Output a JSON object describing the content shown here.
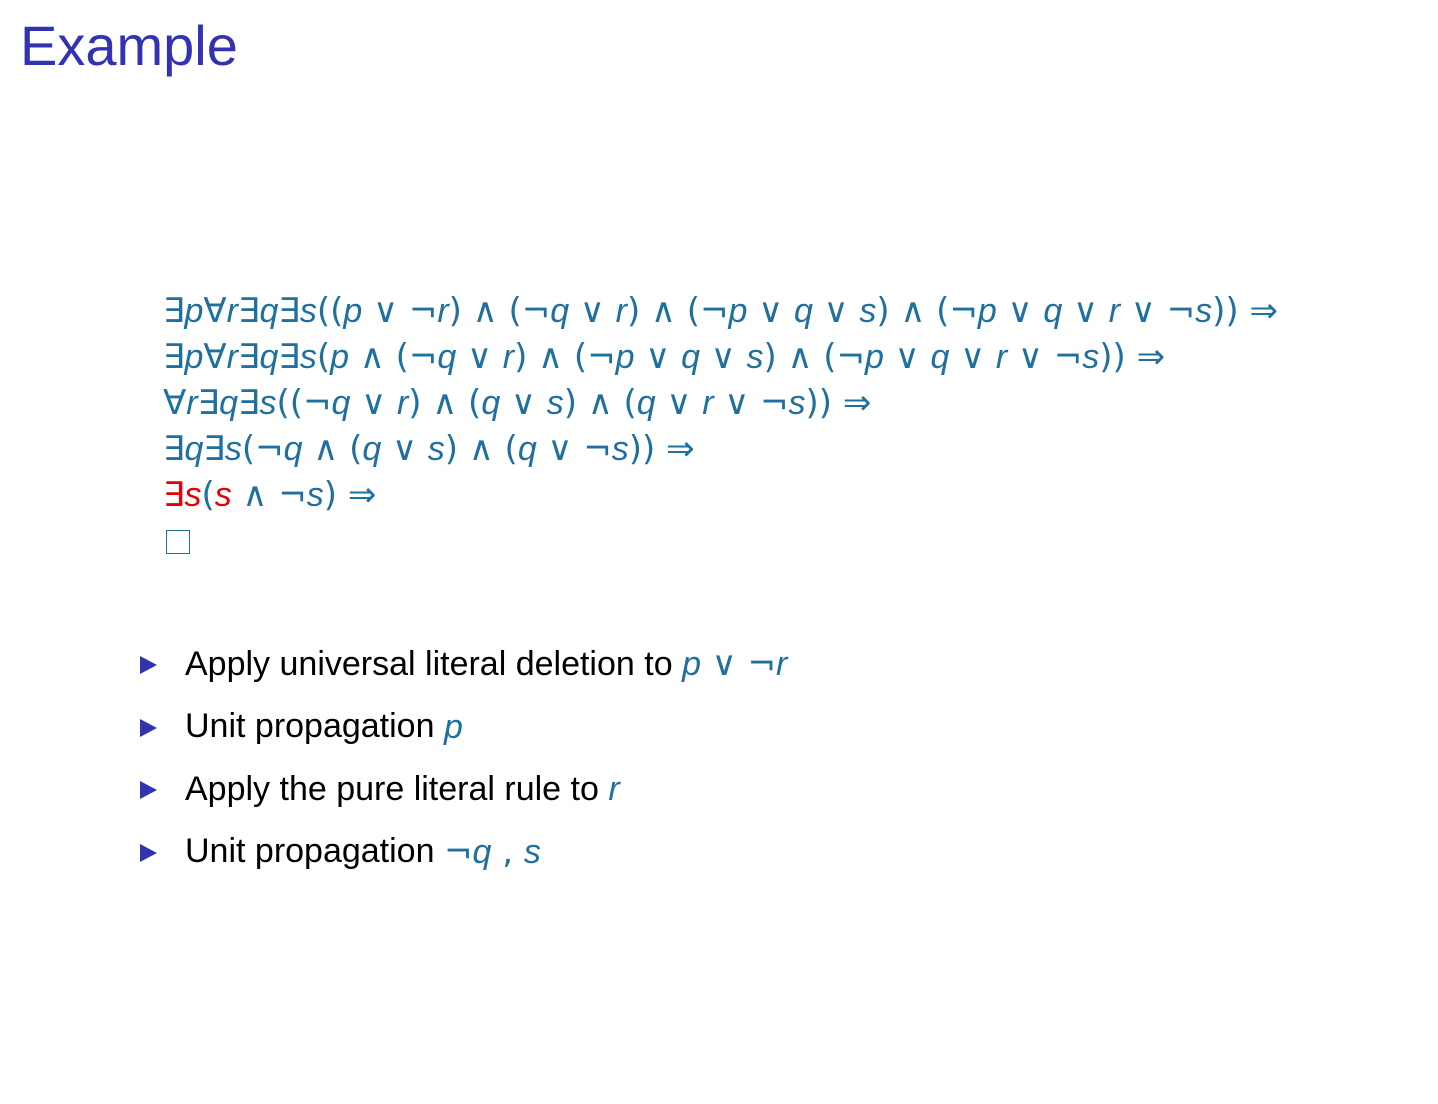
{
  "title": "Example",
  "derivation": {
    "lines": [
      "∃p∀r∃q∃s((p ∨ ¬r) ∧ (¬q ∨ r) ∧ (¬p ∨ q ∨ s) ∧ (¬p ∨ q ∨ r ∨ ¬s)) ⇒",
      "∃p∀r∃q∃s(p ∧ (¬q ∨ r) ∧ (¬p ∨ q ∨ s) ∧ (¬p ∨ q ∨ r ∨ ¬s)) ⇒",
      "∀r∃q∃s((¬q ∨ r) ∧ (q ∨ s) ∧ (q ∨ r ∨ ¬s)) ⇒",
      "∃q∃s(¬q ∧ (q ∨ s) ∧ (q ∨ ¬s)) ⇒",
      "∃s(s ∧ ¬s) ⇒"
    ],
    "highlight_color": "#e60000",
    "formula_color": "#1f6f9f"
  },
  "bullets": [
    {
      "text": "Apply universal literal deletion to",
      "math": "p ∨ ¬r"
    },
    {
      "text": "Unit propagation",
      "math": "p"
    },
    {
      "text": "Apply the pure literal rule to",
      "math": "r"
    },
    {
      "text": "Unit propagation",
      "math": "¬q , s"
    }
  ],
  "colors": {
    "title": "#3333b2",
    "bullet_marker": "#3333b2"
  }
}
